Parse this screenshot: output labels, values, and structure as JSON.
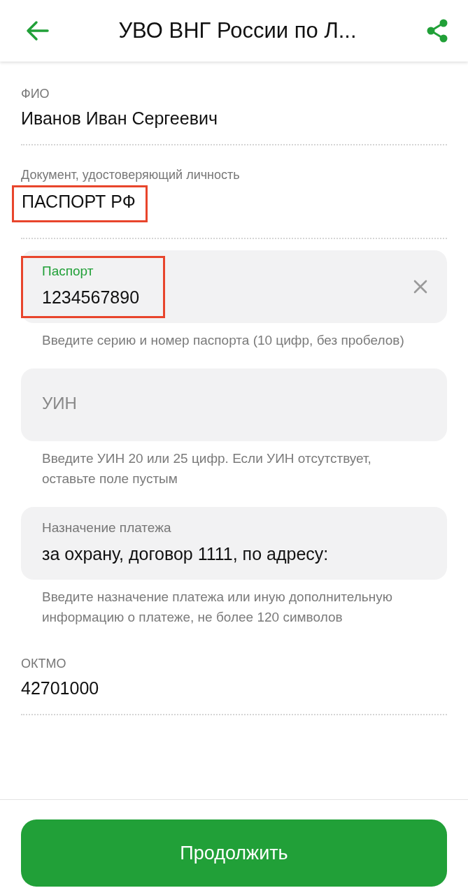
{
  "header": {
    "title": "УВО ВНГ России по Л..."
  },
  "fields": [
    {
      "kind": "static",
      "label": "ФИО",
      "value": "Иванов Иван Сергеевич",
      "highlighted": false
    },
    {
      "kind": "static",
      "label": "Документ, удостоверяющий личность",
      "value": "ПАСПОРТ РФ",
      "highlighted": true
    },
    {
      "kind": "input",
      "label": "Паспорт",
      "value": "1234567890",
      "focused": true,
      "clearable": true,
      "highlighted": true,
      "hint": "Введите серию и номер паспорта (10 цифр, без пробелов)"
    },
    {
      "kind": "input",
      "placeholder": "УИН",
      "focused": false,
      "clearable": false,
      "highlighted": false,
      "hint": "Введите УИН 20 или 25 цифр. Если УИН отсутствует, оставьте поле пустым"
    },
    {
      "kind": "input",
      "label": "Назначение платежа",
      "value": "за охрану, договор 1111, по адресу:",
      "focused": false,
      "clearable": false,
      "highlighted": false,
      "hint": "Введите назначение платежа или иную дополнительную информацию о платеже, не более 120 символов"
    },
    {
      "kind": "static",
      "label": "ОКТМО",
      "value": "42701000",
      "highlighted": false
    }
  ],
  "primary_button": "Продолжить"
}
